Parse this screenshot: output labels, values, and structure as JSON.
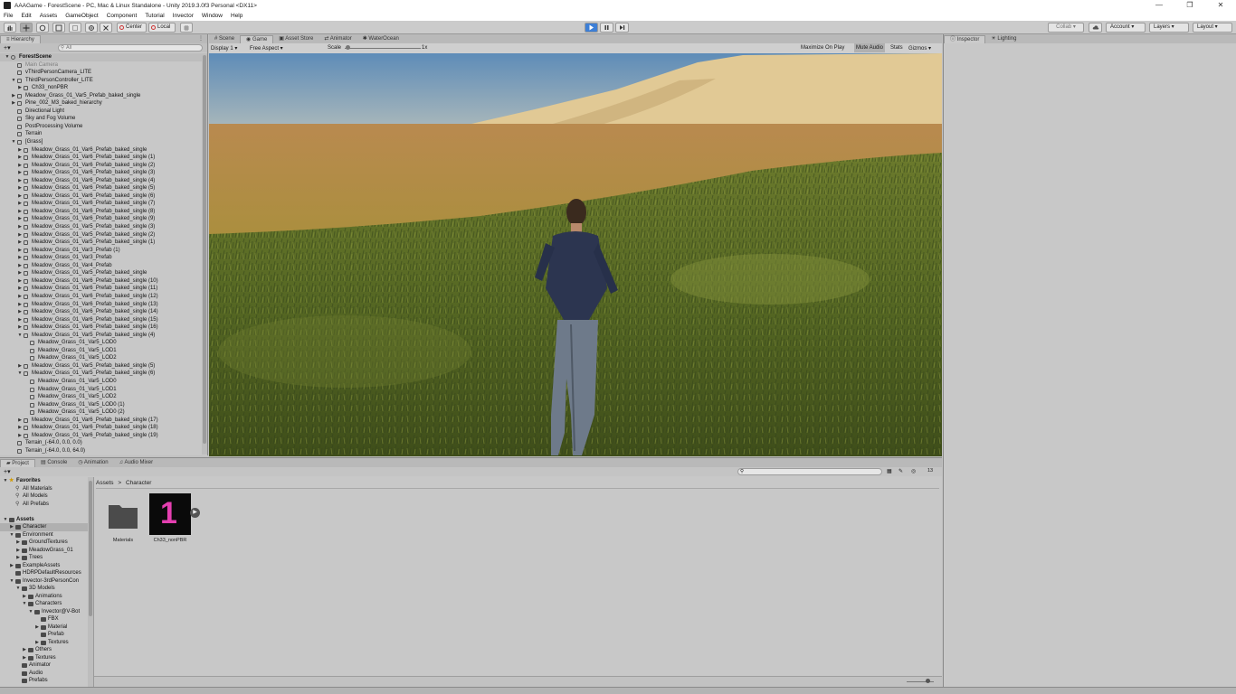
{
  "window": {
    "title": "AAAGame - ForestScene - PC, Mac & Linux Standalone - Unity 2019.3.0f3 Personal <DX11>",
    "controls": [
      "—",
      "❐",
      "✕"
    ]
  },
  "menu": [
    "File",
    "Edit",
    "Assets",
    "GameObject",
    "Component",
    "Tutorial",
    "Invector",
    "Window",
    "Help"
  ],
  "toolbar": {
    "pivot_label": "Center",
    "space_label": "Local",
    "collab_label": "Collab ▾",
    "account_label": "Account ▾",
    "layers_label": "Layers ▾",
    "layout_label": "Layout ▾"
  },
  "hierarchy": {
    "tab_label": "Hierarchy",
    "add_label": "+▾",
    "search_placeholder": "All",
    "rows": [
      {
        "text": "ForestScene",
        "indent": 0,
        "arrow": "▼",
        "kind": "scene"
      },
      {
        "text": "Main Camera",
        "indent": 1,
        "arrow": "",
        "kind": "disabled"
      },
      {
        "text": "vThirdPersonCamera_LITE",
        "indent": 1,
        "arrow": "",
        "kind": "go"
      },
      {
        "text": "ThirdPersonController_LITE",
        "indent": 1,
        "arrow": "▼",
        "kind": "go"
      },
      {
        "text": "Ch33_nonPBR",
        "indent": 2,
        "arrow": "▶",
        "kind": "go"
      },
      {
        "text": "Meadow_Grass_01_Var5_Prefab_baked_single",
        "indent": 1,
        "arrow": "▶",
        "kind": "go"
      },
      {
        "text": "Pine_002_M3_baked_hierarchy",
        "indent": 1,
        "arrow": "▶",
        "kind": "go"
      },
      {
        "text": "Directional Light",
        "indent": 1,
        "arrow": "",
        "kind": "go"
      },
      {
        "text": "Sky and Fog Volume",
        "indent": 1,
        "arrow": "",
        "kind": "go"
      },
      {
        "text": "PostProcessing Volume",
        "indent": 1,
        "arrow": "",
        "kind": "go"
      },
      {
        "text": "Terrain",
        "indent": 1,
        "arrow": "",
        "kind": "go"
      },
      {
        "text": "[Grass]",
        "indent": 1,
        "arrow": "▼",
        "kind": "go"
      },
      {
        "text": "Meadow_Grass_01_Var6_Prefab_baked_single",
        "indent": 2,
        "arrow": "▶",
        "kind": "go"
      },
      {
        "text": "Meadow_Grass_01_Var6_Prefab_baked_single (1)",
        "indent": 2,
        "arrow": "▶",
        "kind": "go"
      },
      {
        "text": "Meadow_Grass_01_Var6_Prefab_baked_single (2)",
        "indent": 2,
        "arrow": "▶",
        "kind": "go"
      },
      {
        "text": "Meadow_Grass_01_Var6_Prefab_baked_single (3)",
        "indent": 2,
        "arrow": "▶",
        "kind": "go"
      },
      {
        "text": "Meadow_Grass_01_Var6_Prefab_baked_single (4)",
        "indent": 2,
        "arrow": "▶",
        "kind": "go"
      },
      {
        "text": "Meadow_Grass_01_Var6_Prefab_baked_single (5)",
        "indent": 2,
        "arrow": "▶",
        "kind": "go"
      },
      {
        "text": "Meadow_Grass_01_Var6_Prefab_baked_single (6)",
        "indent": 2,
        "arrow": "▶",
        "kind": "go"
      },
      {
        "text": "Meadow_Grass_01_Var6_Prefab_baked_single (7)",
        "indent": 2,
        "arrow": "▶",
        "kind": "go"
      },
      {
        "text": "Meadow_Grass_01_Var6_Prefab_baked_single (8)",
        "indent": 2,
        "arrow": "▶",
        "kind": "go"
      },
      {
        "text": "Meadow_Grass_01_Var6_Prefab_baked_single (9)",
        "indent": 2,
        "arrow": "▶",
        "kind": "go"
      },
      {
        "text": "Meadow_Grass_01_Var5_Prefab_baked_single (3)",
        "indent": 2,
        "arrow": "▶",
        "kind": "go"
      },
      {
        "text": "Meadow_Grass_01_Var5_Prefab_baked_single (2)",
        "indent": 2,
        "arrow": "▶",
        "kind": "go"
      },
      {
        "text": "Meadow_Grass_01_Var5_Prefab_baked_single (1)",
        "indent": 2,
        "arrow": "▶",
        "kind": "go"
      },
      {
        "text": "Meadow_Grass_01_Var3_Prefab (1)",
        "indent": 2,
        "arrow": "▶",
        "kind": "go"
      },
      {
        "text": "Meadow_Grass_01_Var3_Prefab",
        "indent": 2,
        "arrow": "▶",
        "kind": "go"
      },
      {
        "text": "Meadow_Grass_01_Var4_Prefab",
        "indent": 2,
        "arrow": "▶",
        "kind": "go"
      },
      {
        "text": "Meadow_Grass_01_Var5_Prefab_baked_single",
        "indent": 2,
        "arrow": "▶",
        "kind": "go"
      },
      {
        "text": "Meadow_Grass_01_Var6_Prefab_baked_single (10)",
        "indent": 2,
        "arrow": "▶",
        "kind": "go"
      },
      {
        "text": "Meadow_Grass_01_Var6_Prefab_baked_single (11)",
        "indent": 2,
        "arrow": "▶",
        "kind": "go"
      },
      {
        "text": "Meadow_Grass_01_Var6_Prefab_baked_single (12)",
        "indent": 2,
        "arrow": "▶",
        "kind": "go"
      },
      {
        "text": "Meadow_Grass_01_Var6_Prefab_baked_single (13)",
        "indent": 2,
        "arrow": "▶",
        "kind": "go"
      },
      {
        "text": "Meadow_Grass_01_Var6_Prefab_baked_single (14)",
        "indent": 2,
        "arrow": "▶",
        "kind": "go"
      },
      {
        "text": "Meadow_Grass_01_Var6_Prefab_baked_single (15)",
        "indent": 2,
        "arrow": "▶",
        "kind": "go"
      },
      {
        "text": "Meadow_Grass_01_Var6_Prefab_baked_single (16)",
        "indent": 2,
        "arrow": "▶",
        "kind": "go"
      },
      {
        "text": "Meadow_Grass_01_Var5_Prefab_baked_single (4)",
        "indent": 2,
        "arrow": "▼",
        "kind": "go"
      },
      {
        "text": "Meadow_Grass_01_Var5_LOD0",
        "indent": 3,
        "arrow": "",
        "kind": "go"
      },
      {
        "text": "Meadow_Grass_01_Var5_LOD1",
        "indent": 3,
        "arrow": "",
        "kind": "go"
      },
      {
        "text": "Meadow_Grass_01_Var5_LOD2",
        "indent": 3,
        "arrow": "",
        "kind": "go"
      },
      {
        "text": "Meadow_Grass_01_Var5_Prefab_baked_single (5)",
        "indent": 2,
        "arrow": "▶",
        "kind": "go"
      },
      {
        "text": "Meadow_Grass_01_Var5_Prefab_baked_single (6)",
        "indent": 2,
        "arrow": "▼",
        "kind": "go"
      },
      {
        "text": "Meadow_Grass_01_Var5_LOD0",
        "indent": 3,
        "arrow": "",
        "kind": "go"
      },
      {
        "text": "Meadow_Grass_01_Var5_LOD1",
        "indent": 3,
        "arrow": "",
        "kind": "go"
      },
      {
        "text": "Meadow_Grass_01_Var5_LOD2",
        "indent": 3,
        "arrow": "",
        "kind": "go"
      },
      {
        "text": "Meadow_Grass_01_Var5_LOD0 (1)",
        "indent": 3,
        "arrow": "",
        "kind": "go"
      },
      {
        "text": "Meadow_Grass_01_Var5_LOD0 (2)",
        "indent": 3,
        "arrow": "",
        "kind": "go"
      },
      {
        "text": "Meadow_Grass_01_Var6_Prefab_baked_single (17)",
        "indent": 2,
        "arrow": "▶",
        "kind": "go"
      },
      {
        "text": "Meadow_Grass_01_Var6_Prefab_baked_single (18)",
        "indent": 2,
        "arrow": "▶",
        "kind": "go"
      },
      {
        "text": "Meadow_Grass_01_Var6_Prefab_baked_single (19)",
        "indent": 2,
        "arrow": "▶",
        "kind": "go"
      },
      {
        "text": "Terrain_(-64.0, 0.0, 0.0)",
        "indent": 1,
        "arrow": "",
        "kind": "go"
      },
      {
        "text": "Terrain_(-64.0, 0.0, 64.0)",
        "indent": 1,
        "arrow": "",
        "kind": "go"
      }
    ]
  },
  "center_tabs": {
    "scene": "Scene",
    "game": "Game",
    "asset_store": "Asset Store",
    "animator": "Animator",
    "water": "WaterOcean"
  },
  "game_bar": {
    "display": "Display 1 ▾",
    "aspect": "Free Aspect ▾",
    "scale_label": "Scale",
    "scale_value": "1x",
    "maximize": "Maximize On Play",
    "mute": "Mute Audio",
    "stats": "Stats",
    "gizmos": "Gizmos ▾"
  },
  "inspector": {
    "tab_label": "Inspector",
    "lighting_label": "Lighting"
  },
  "bottom_tabs": {
    "project": "Project",
    "console": "Console",
    "animation": "Animation",
    "audio_mixer": "Audio Mixer"
  },
  "project": {
    "add_label": "+▾",
    "hidden_count": "13",
    "breadcrumb_root": "Assets",
    "breadcrumb_sep": ">",
    "breadcrumb_current": "Character",
    "tree": [
      {
        "text": "Favorites",
        "indent": 0,
        "arrow": "▼",
        "kind": "star"
      },
      {
        "text": "All Materials",
        "indent": 1,
        "arrow": "",
        "kind": "search"
      },
      {
        "text": "All Models",
        "indent": 1,
        "arrow": "",
        "kind": "search"
      },
      {
        "text": "All Prefabs",
        "indent": 1,
        "arrow": "",
        "kind": "search"
      },
      {
        "text": "",
        "indent": 0,
        "arrow": "",
        "kind": "blank"
      },
      {
        "text": "Assets",
        "indent": 0,
        "arrow": "▼",
        "kind": "bold"
      },
      {
        "text": "Character",
        "indent": 1,
        "arrow": "▶",
        "kind": "sel"
      },
      {
        "text": "Environment",
        "indent": 1,
        "arrow": "▼",
        "kind": "folder"
      },
      {
        "text": "GroundTextures",
        "indent": 2,
        "arrow": "▶",
        "kind": "folder"
      },
      {
        "text": "MeadowGrass_01",
        "indent": 2,
        "arrow": "▶",
        "kind": "folder"
      },
      {
        "text": "Trees",
        "indent": 2,
        "arrow": "▶",
        "kind": "folder"
      },
      {
        "text": "ExampleAssets",
        "indent": 1,
        "arrow": "▶",
        "kind": "folder"
      },
      {
        "text": "HDRPDefaultResources",
        "indent": 1,
        "arrow": "",
        "kind": "folder"
      },
      {
        "text": "Invector-3rdPersonCon",
        "indent": 1,
        "arrow": "▼",
        "kind": "folder"
      },
      {
        "text": "3D Models",
        "indent": 2,
        "arrow": "▼",
        "kind": "folder"
      },
      {
        "text": "Animations",
        "indent": 3,
        "arrow": "▶",
        "kind": "folder"
      },
      {
        "text": "Characters",
        "indent": 3,
        "arrow": "▼",
        "kind": "folder"
      },
      {
        "text": "Invector@V-Bot",
        "indent": 4,
        "arrow": "▼",
        "kind": "folder"
      },
      {
        "text": "FBX",
        "indent": 5,
        "arrow": "",
        "kind": "folder"
      },
      {
        "text": "Material",
        "indent": 5,
        "arrow": "▶",
        "kind": "folder"
      },
      {
        "text": "Prefab",
        "indent": 5,
        "arrow": "",
        "kind": "folder"
      },
      {
        "text": "Textures",
        "indent": 5,
        "arrow": "▶",
        "kind": "folder"
      },
      {
        "text": "Others",
        "indent": 3,
        "arrow": "▶",
        "kind": "folder"
      },
      {
        "text": "Textures",
        "indent": 3,
        "arrow": "▶",
        "kind": "folder"
      },
      {
        "text": "Animator",
        "indent": 2,
        "arrow": "",
        "kind": "folder"
      },
      {
        "text": "Audio",
        "indent": 2,
        "arrow": "",
        "kind": "folder"
      },
      {
        "text": "Prefabs",
        "indent": 2,
        "arrow": "",
        "kind": "folder"
      }
    ],
    "assets": [
      {
        "name": "Materials",
        "type": "folder"
      },
      {
        "name": "Ch33_nonPBR",
        "type": "model"
      }
    ]
  },
  "colors": {
    "play_accent": "#3d7fd6",
    "panel_bg": "#c8c8c8",
    "model_thumb_glyph": "#e43fb0"
  }
}
